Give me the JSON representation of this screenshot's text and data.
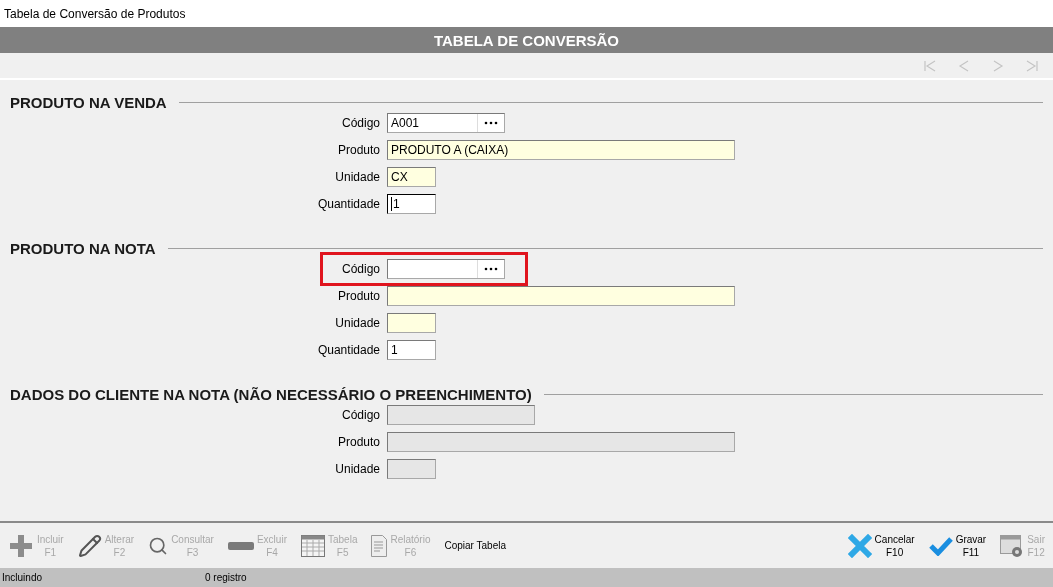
{
  "window": {
    "title": "Tabela de Conversão de Produtos"
  },
  "header": {
    "title": "TABELA DE CONVERSÃO"
  },
  "navigation": [
    {
      "kind": "first",
      "disabled": true
    },
    {
      "kind": "prev",
      "disabled": true
    },
    {
      "kind": "next",
      "disabled": true
    },
    {
      "kind": "last",
      "disabled": true
    }
  ],
  "sections": [
    {
      "title": "PRODUTO NA VENDA",
      "fields": [
        {
          "label": "Código",
          "kind": "lookup",
          "value": "A001",
          "disabled": false,
          "focused": false,
          "highlighted": false
        },
        {
          "label": "Produto",
          "kind": "description",
          "value": "PRODUTO A (CAIXA)",
          "disabled": false,
          "focused": false,
          "highlighted": false
        },
        {
          "label": "Unidade",
          "kind": "unit",
          "value": "CX",
          "disabled": false,
          "focused": false,
          "highlighted": false
        },
        {
          "label": "Quantidade",
          "kind": "quantity",
          "value": "1",
          "disabled": false,
          "focused": true,
          "highlighted": false
        }
      ]
    },
    {
      "title": "PRODUTO NA NOTA",
      "fields": [
        {
          "label": "Código",
          "kind": "lookup",
          "disabled": false,
          "focused": false,
          "highlighted": true
        },
        {
          "label": "Produto",
          "kind": "description",
          "disabled": false,
          "focused": false,
          "highlighted": false
        },
        {
          "label": "Unidade",
          "kind": "unit",
          "disabled": false,
          "focused": false,
          "highlighted": false
        },
        {
          "label": "Quantidade",
          "kind": "quantity",
          "value": "1",
          "disabled": false,
          "focused": false,
          "highlighted": false
        }
      ]
    },
    {
      "title": "DADOS DO CLIENTE NA NOTA (NÃO NECESSÁRIO O PREENCHIMENTO)",
      "fields": [
        {
          "label": "Código",
          "kind": "lookup",
          "disabled": true,
          "focused": false,
          "highlighted": false
        },
        {
          "label": "Produto",
          "kind": "description",
          "disabled": true,
          "focused": false,
          "highlighted": false
        },
        {
          "label": "Unidade",
          "kind": "unit",
          "disabled": true,
          "focused": false,
          "highlighted": false
        }
      ]
    }
  ],
  "toolbar_left": [
    {
      "kind": "add",
      "label": "Incluir",
      "key": "F1",
      "disabled": true
    },
    {
      "kind": "edit",
      "label": "Alterar",
      "key": "F2",
      "disabled": true
    },
    {
      "kind": "search",
      "label": "Consultar",
      "key": "F3",
      "disabled": true
    },
    {
      "kind": "delete",
      "label": "Excluir",
      "key": "F4",
      "disabled": true
    },
    {
      "kind": "table",
      "label": "Tabela",
      "key": "F5",
      "disabled": true
    },
    {
      "kind": "report",
      "label": "Relatório",
      "key": "F6",
      "disabled": true
    },
    {
      "kind": "text",
      "label": "Copiar Tabela",
      "disabled": false
    }
  ],
  "toolbar_right": [
    {
      "kind": "cancel",
      "label": "Cancelar",
      "key": "F10",
      "disabled": false
    },
    {
      "kind": "save",
      "label": "Gravar",
      "key": "F11",
      "disabled": false
    },
    {
      "kind": "exit",
      "label": "Sair",
      "key": "F12",
      "disabled": true
    }
  ],
  "status_bar": {
    "mode": "Incluindo",
    "count": "0 registro"
  }
}
